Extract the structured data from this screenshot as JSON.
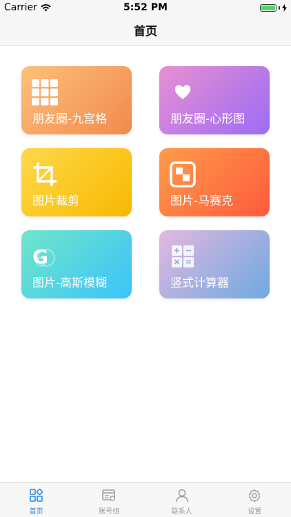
{
  "status_bar": {
    "carrier": "Carrier",
    "time": "5:52 PM"
  },
  "nav": {
    "title": "首页"
  },
  "tiles": [
    {
      "label": "朋友圈-九宫格",
      "icon": "grid-nine-icon",
      "gradient": [
        "#fdc07a",
        "#f28a4e"
      ]
    },
    {
      "label": "朋友圈-心形图",
      "icon": "heart-icon",
      "gradient": [
        "#e88fd1",
        "#9c6cf5"
      ]
    },
    {
      "label": "图片裁剪",
      "icon": "crop-icon",
      "gradient": [
        "#ffd84a",
        "#f8b900"
      ]
    },
    {
      "label": "图片-马赛克",
      "icon": "mosaic-icon",
      "gradient": [
        "#ff9c4a",
        "#ff5a3c"
      ]
    },
    {
      "label": "图片-高斯模糊",
      "icon": "gaussian-blur-icon",
      "gradient": [
        "#6fe6c9",
        "#3cc3fb"
      ]
    },
    {
      "label": "竖式计算器",
      "icon": "calculator-icon",
      "gradient": [
        "#e2b8e0",
        "#6fa9e0"
      ]
    }
  ],
  "tab_bar": {
    "items": [
      {
        "label": "首页",
        "icon": "home-grid-icon",
        "active": true
      },
      {
        "label": "账号组",
        "icon": "account-group-icon",
        "active": false
      },
      {
        "label": "联系人",
        "icon": "contact-person-icon",
        "active": false
      },
      {
        "label": "设置",
        "icon": "settings-gear-icon",
        "active": false
      }
    ]
  },
  "colors": {
    "accent": "#1d8bf1",
    "battery": "#4cd964"
  }
}
